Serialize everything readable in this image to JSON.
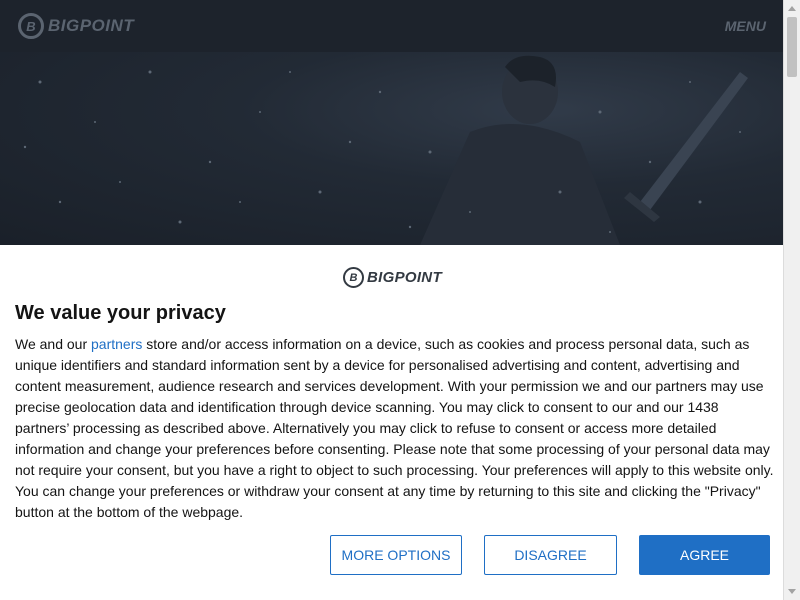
{
  "site": {
    "logo_mark": "B",
    "logo_text": "BIGPOINT",
    "menu_label": "MENU"
  },
  "dialog": {
    "logo_mark": "B",
    "logo_text": "BIGPOINT",
    "title": "We value your privacy",
    "body_prefix": "We and our ",
    "partners_link": "partners",
    "body_rest": " store and/or access information on a device, such as cookies and process personal data, such as unique identifiers and standard information sent by a device for personalised advertising and content, advertising and content measurement, audience research and services development. With your permission we and our partners may use precise geolocation data and identification through device scanning. You may click to consent to our and our 1438 partners’ processing as described above. Alternatively you may click to refuse to consent or access more detailed information and change your preferences before consenting. Please note that some processing of your personal data may not require your consent, but you have a right to object to such processing. Your preferences will apply to this website only. You can change your preferences or withdraw your consent at any time by returning to this site and clicking the \"Privacy\" button at the bottom of the webpage.",
    "buttons": {
      "more_options": "MORE OPTIONS",
      "disagree": "DISAGREE",
      "agree": "AGREE"
    }
  },
  "colors": {
    "accent": "#1f6fc5",
    "header_bg": "#1d232c"
  }
}
